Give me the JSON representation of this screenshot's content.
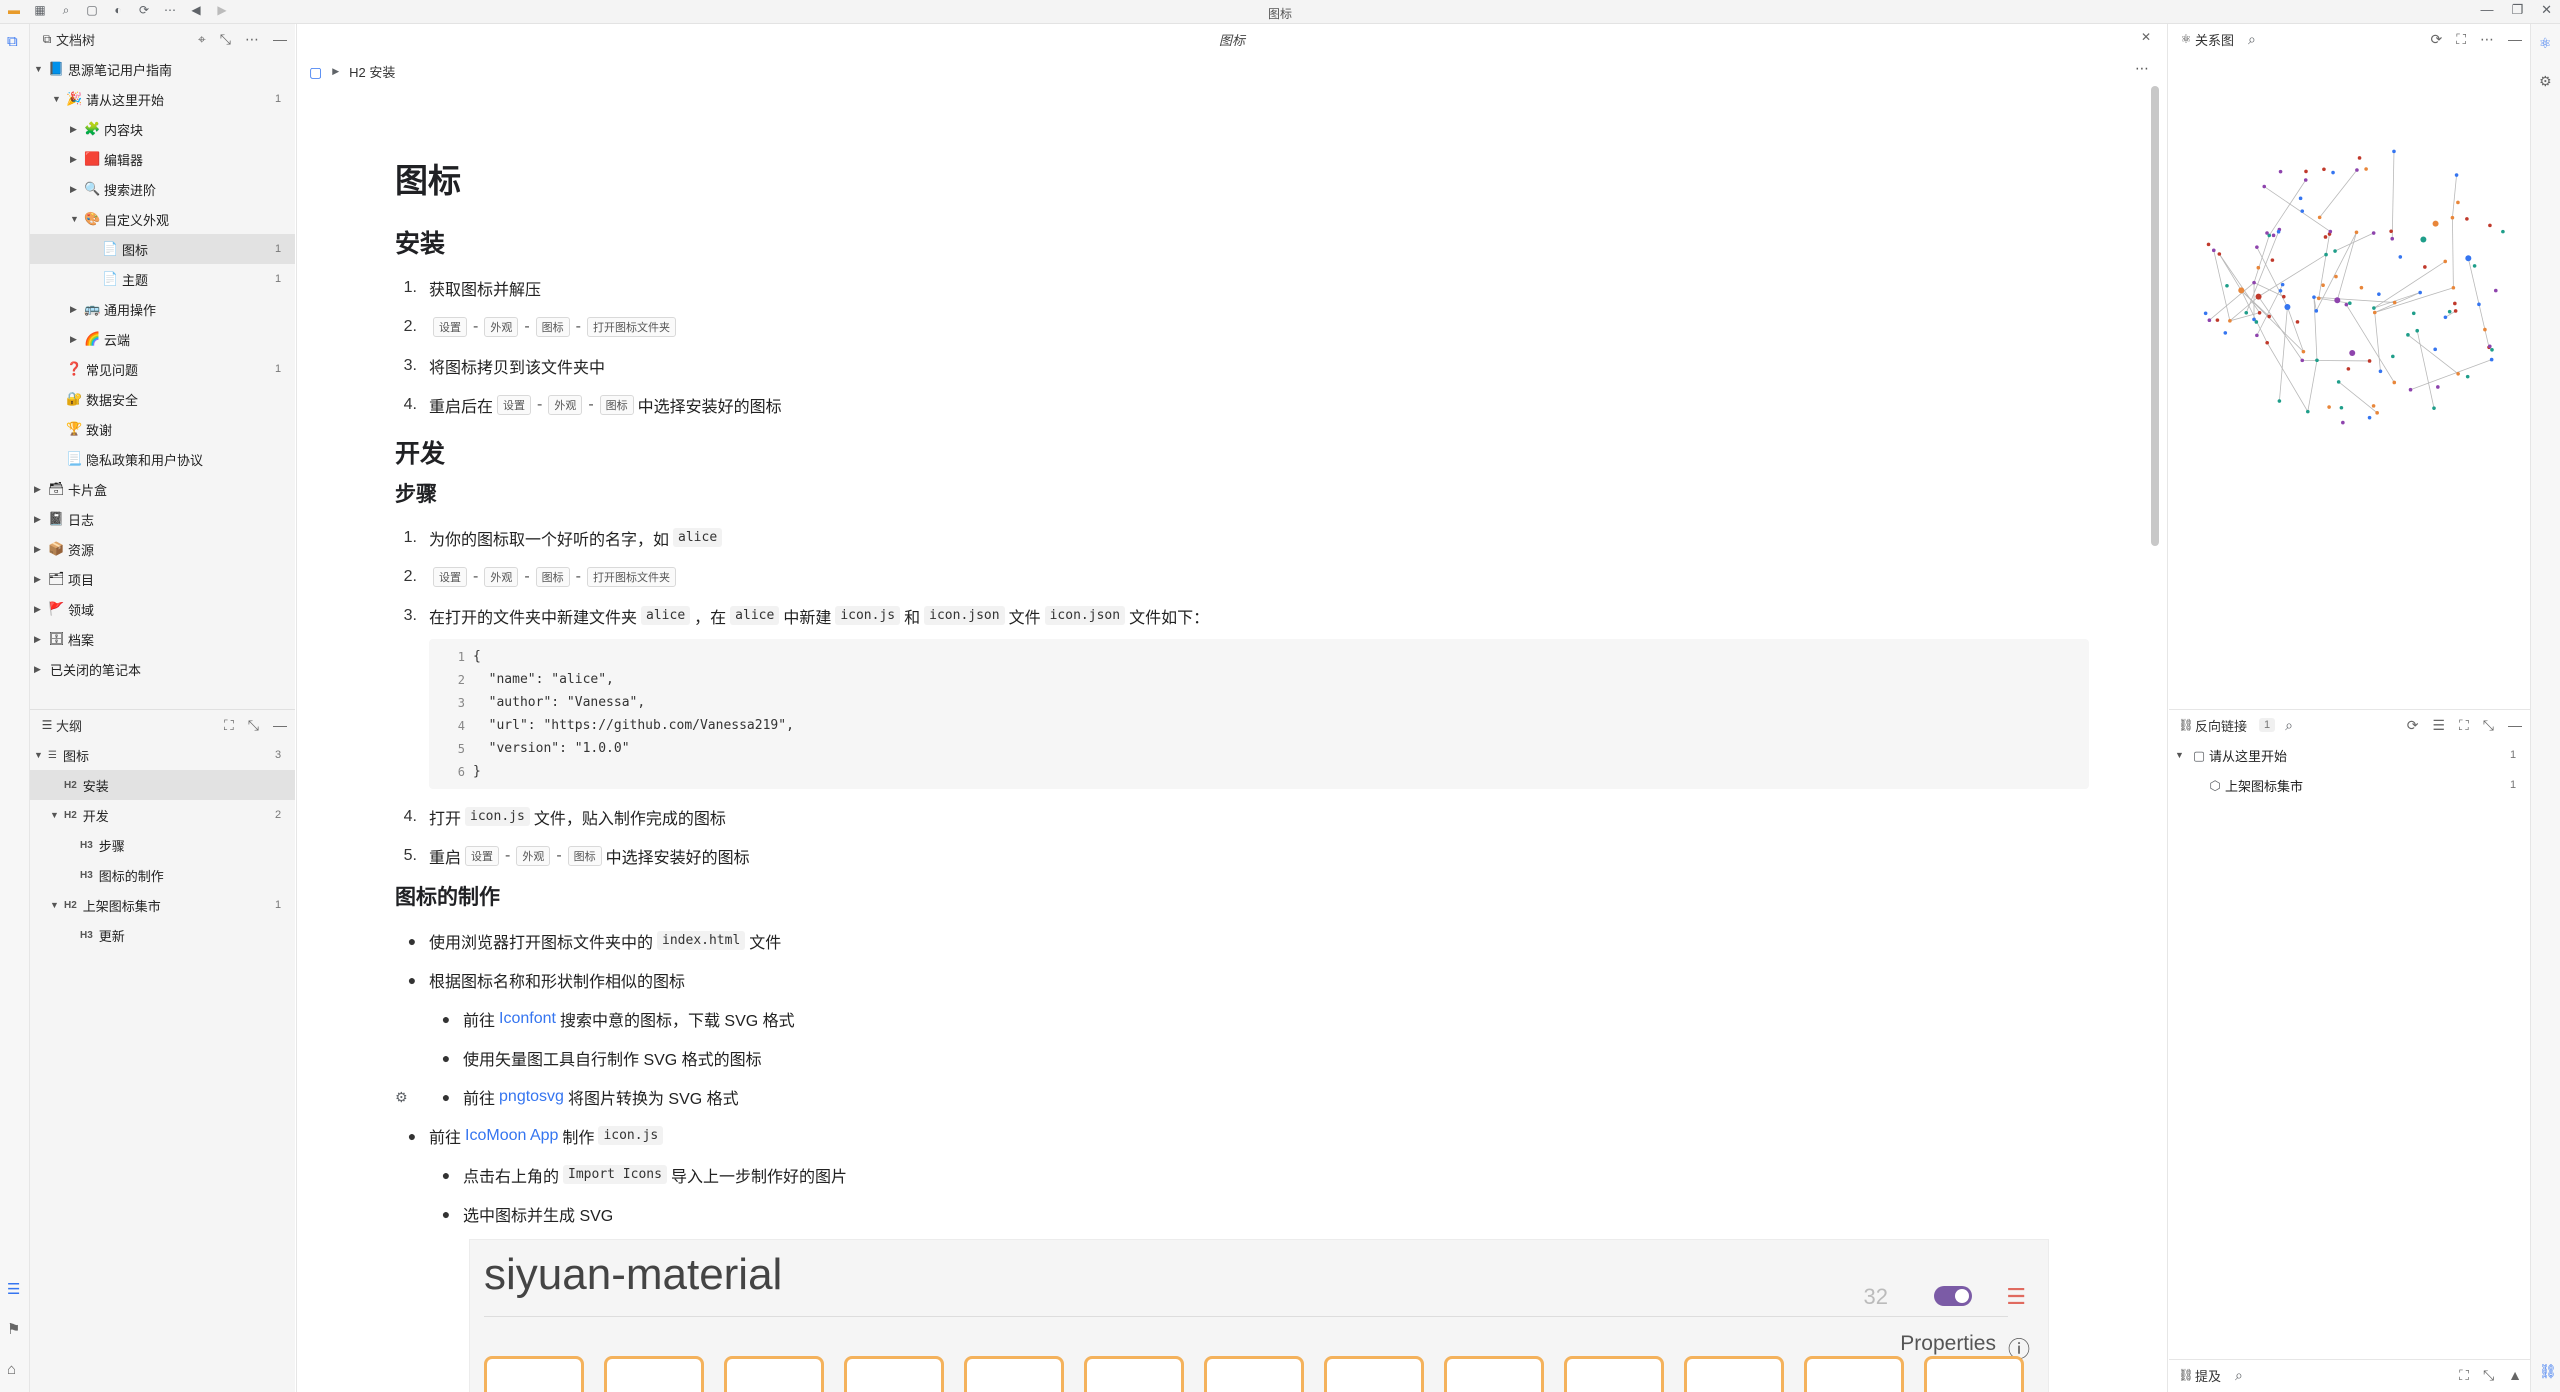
{
  "window": {
    "title": "图标"
  },
  "file_tree": {
    "title": "文档树",
    "rows": [
      {
        "label": "思源笔记用户指南",
        "icon": "📘",
        "count": "",
        "expanded": true
      },
      {
        "label": "请从这里开始",
        "icon": "🎉",
        "count": "1",
        "expanded": true
      },
      {
        "label": "内容块",
        "icon": "🧩",
        "count": ""
      },
      {
        "label": "编辑器",
        "icon": "🟥",
        "count": ""
      },
      {
        "label": "搜索进阶",
        "icon": "🔍",
        "count": ""
      },
      {
        "label": "自定义外观",
        "icon": "🎨",
        "count": "",
        "expanded": true
      },
      {
        "label": "图标",
        "icon": "📄",
        "count": "1"
      },
      {
        "label": "主题",
        "icon": "📄",
        "count": "1"
      },
      {
        "label": "通用操作",
        "icon": "🚌",
        "count": ""
      },
      {
        "label": "云端",
        "icon": "🌈",
        "count": ""
      },
      {
        "label": "常见问题",
        "icon": "❓",
        "count": "1"
      },
      {
        "label": "数据安全",
        "icon": "🔐",
        "count": ""
      },
      {
        "label": "致谢",
        "icon": "🏆",
        "count": ""
      },
      {
        "label": "隐私政策和用户协议",
        "icon": "📃",
        "count": ""
      },
      {
        "label": "卡片盒",
        "icon": "🗃",
        "count": ""
      },
      {
        "label": "日志",
        "icon": "📓",
        "count": ""
      },
      {
        "label": "资源",
        "icon": "📦",
        "count": ""
      },
      {
        "label": "项目",
        "icon": "🗂",
        "count": ""
      },
      {
        "label": "领域",
        "icon": "🚩",
        "count": ""
      },
      {
        "label": "档案",
        "icon": "🗄",
        "count": ""
      }
    ],
    "closed_notebooks": "已关闭的笔记本"
  },
  "outline": {
    "title": "大纲",
    "rows": [
      {
        "tag": "",
        "label": "图标",
        "count": "3"
      },
      {
        "tag": "H2",
        "label": "安装",
        "count": ""
      },
      {
        "tag": "H2",
        "label": "开发",
        "count": "2"
      },
      {
        "tag": "H3",
        "label": "步骤",
        "count": ""
      },
      {
        "tag": "H3",
        "label": "图标的制作",
        "count": ""
      },
      {
        "tag": "H2",
        "label": "上架图标集市",
        "count": "1"
      },
      {
        "tag": "H3",
        "label": "更新",
        "count": ""
      }
    ]
  },
  "editor": {
    "tab_title": "图标",
    "breadcrumb": "H2 安装",
    "h1": "图标",
    "install": {
      "heading": "安装",
      "step1": "获取图标并解压",
      "step3": "将图标拷贝到该文件夹中",
      "step4_prefix": "重启后在",
      "step4_suffix": "中选择安装好的图标"
    },
    "kbd": {
      "settings": "设置",
      "appearance": "外观",
      "icon": "图标",
      "open_folder": "打开图标文件夹"
    },
    "dev": {
      "heading": "开发",
      "steps_heading": "步骤",
      "s1_text": "为你的图标取一个好听的名字，如",
      "s1_code": "alice",
      "s3_a": "在打开的文件夹中新建文件夹",
      "s3_code_alice": "alice",
      "s3_b": "，在",
      "s3_c": "中新建",
      "s3_code_js": "icon.js",
      "s3_d": "和",
      "s3_code_json": "icon.json",
      "s3_e": "文件",
      "s3_f": "文件如下：",
      "s4_a": "打开",
      "s4_b": "文件，贴入制作完成的图标",
      "s5_a": "重启",
      "s5_b": "中选择安装好的图标"
    },
    "code_lines": [
      {
        "n": "1",
        "t": "{"
      },
      {
        "n": "2",
        "t": "  \"name\": \"alice\","
      },
      {
        "n": "3",
        "t": "  \"author\": \"Vanessa\","
      },
      {
        "n": "4",
        "t": "  \"url\": \"https://github.com/Vanessa219\","
      },
      {
        "n": "5",
        "t": "  \"version\": \"1.0.0\""
      },
      {
        "n": "6",
        "t": "}"
      }
    ],
    "make": {
      "heading": "图标的制作",
      "b1_a": "使用浏览器打开图标文件夹中的",
      "b1_code": "index.html",
      "b1_b": "文件",
      "b2": "根据图标名称和形状制作相似的图标",
      "b2_1_a": "前往",
      "b2_1_link": "Iconfont",
      "b2_1_b": "搜索中意的图标，下载 SVG 格式",
      "b2_2": "使用矢量图工具自行制作 SVG 格式的图标",
      "b2_3_a": "前往",
      "b2_3_link": "pngtosvg",
      "b2_3_b": "将图片转换为 SVG 格式",
      "b3_a": "前往",
      "b3_link": "IcoMoon App",
      "b3_b": "制作",
      "b3_code": "icon.js",
      "b3_1_a": "点击右上角的",
      "b3_1_code": "Import Icons",
      "b3_1_b": "导入上一步制作好的图片",
      "b3_2": "选中图标并生成 SVG"
    },
    "screenshot": {
      "title": "siyuan-material",
      "count": "32",
      "properties": "Properties"
    }
  },
  "graph": {
    "title": "关系图"
  },
  "backlinks": {
    "title": "反向链接",
    "count": "1",
    "rows": [
      {
        "label": "请从这里开始",
        "count": "1"
      },
      {
        "label": "上架图标集市",
        "count": "1"
      }
    ]
  },
  "mentions": {
    "title": "提及"
  },
  "colors": {
    "accent": "#3575f0",
    "graph_node_orange": "#e8863a",
    "graph_node_teal": "#1f9e8a"
  }
}
